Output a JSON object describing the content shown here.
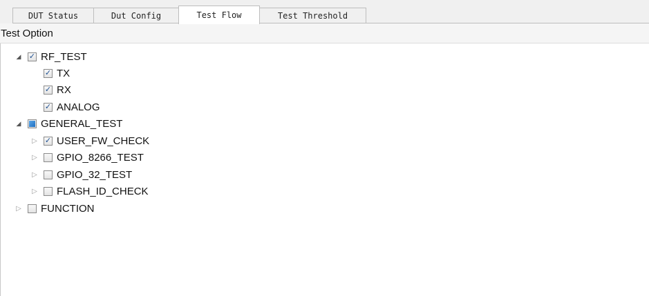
{
  "tabs": [
    {
      "label": "DUT Status",
      "active": false
    },
    {
      "label": "Dut Config",
      "active": false
    },
    {
      "label": "Test Flow",
      "active": true
    },
    {
      "label": "Test Threshold",
      "active": false
    }
  ],
  "section": {
    "title": "Test Option"
  },
  "tree": {
    "rf_test": {
      "label": "RF_TEST",
      "state": "checked",
      "expanded": true,
      "children": {
        "tx": {
          "label": "TX",
          "state": "checked"
        },
        "rx": {
          "label": "RX",
          "state": "checked"
        },
        "analog": {
          "label": "ANALOG",
          "state": "checked"
        }
      }
    },
    "general_test": {
      "label": "GENERAL_TEST",
      "state": "partial",
      "expanded": true,
      "children": {
        "user_fw_check": {
          "label": "USER_FW_CHECK",
          "state": "checked",
          "expanded": false
        },
        "gpio_8266_test": {
          "label": "GPIO_8266_TEST",
          "state": "unchecked",
          "expanded": false
        },
        "gpio_32_test": {
          "label": "GPIO_32_TEST",
          "state": "unchecked",
          "expanded": false
        },
        "flash_id_check": {
          "label": "FLASH_ID_CHECK",
          "state": "unchecked",
          "expanded": false
        }
      }
    },
    "function": {
      "label": "FUNCTION",
      "state": "unchecked",
      "expanded": false
    }
  },
  "icons": {
    "expanded": "triangle-down-right-icon",
    "collapsed": "triangle-right-outline-icon",
    "checkbox_checked": "checkmark-icon",
    "checkbox_partial": "filled-square-icon"
  },
  "colors": {
    "accent_check": "#1d4f91",
    "partial_fill": "#1f6fc1",
    "tab_bg": "#f0f0f0"
  }
}
